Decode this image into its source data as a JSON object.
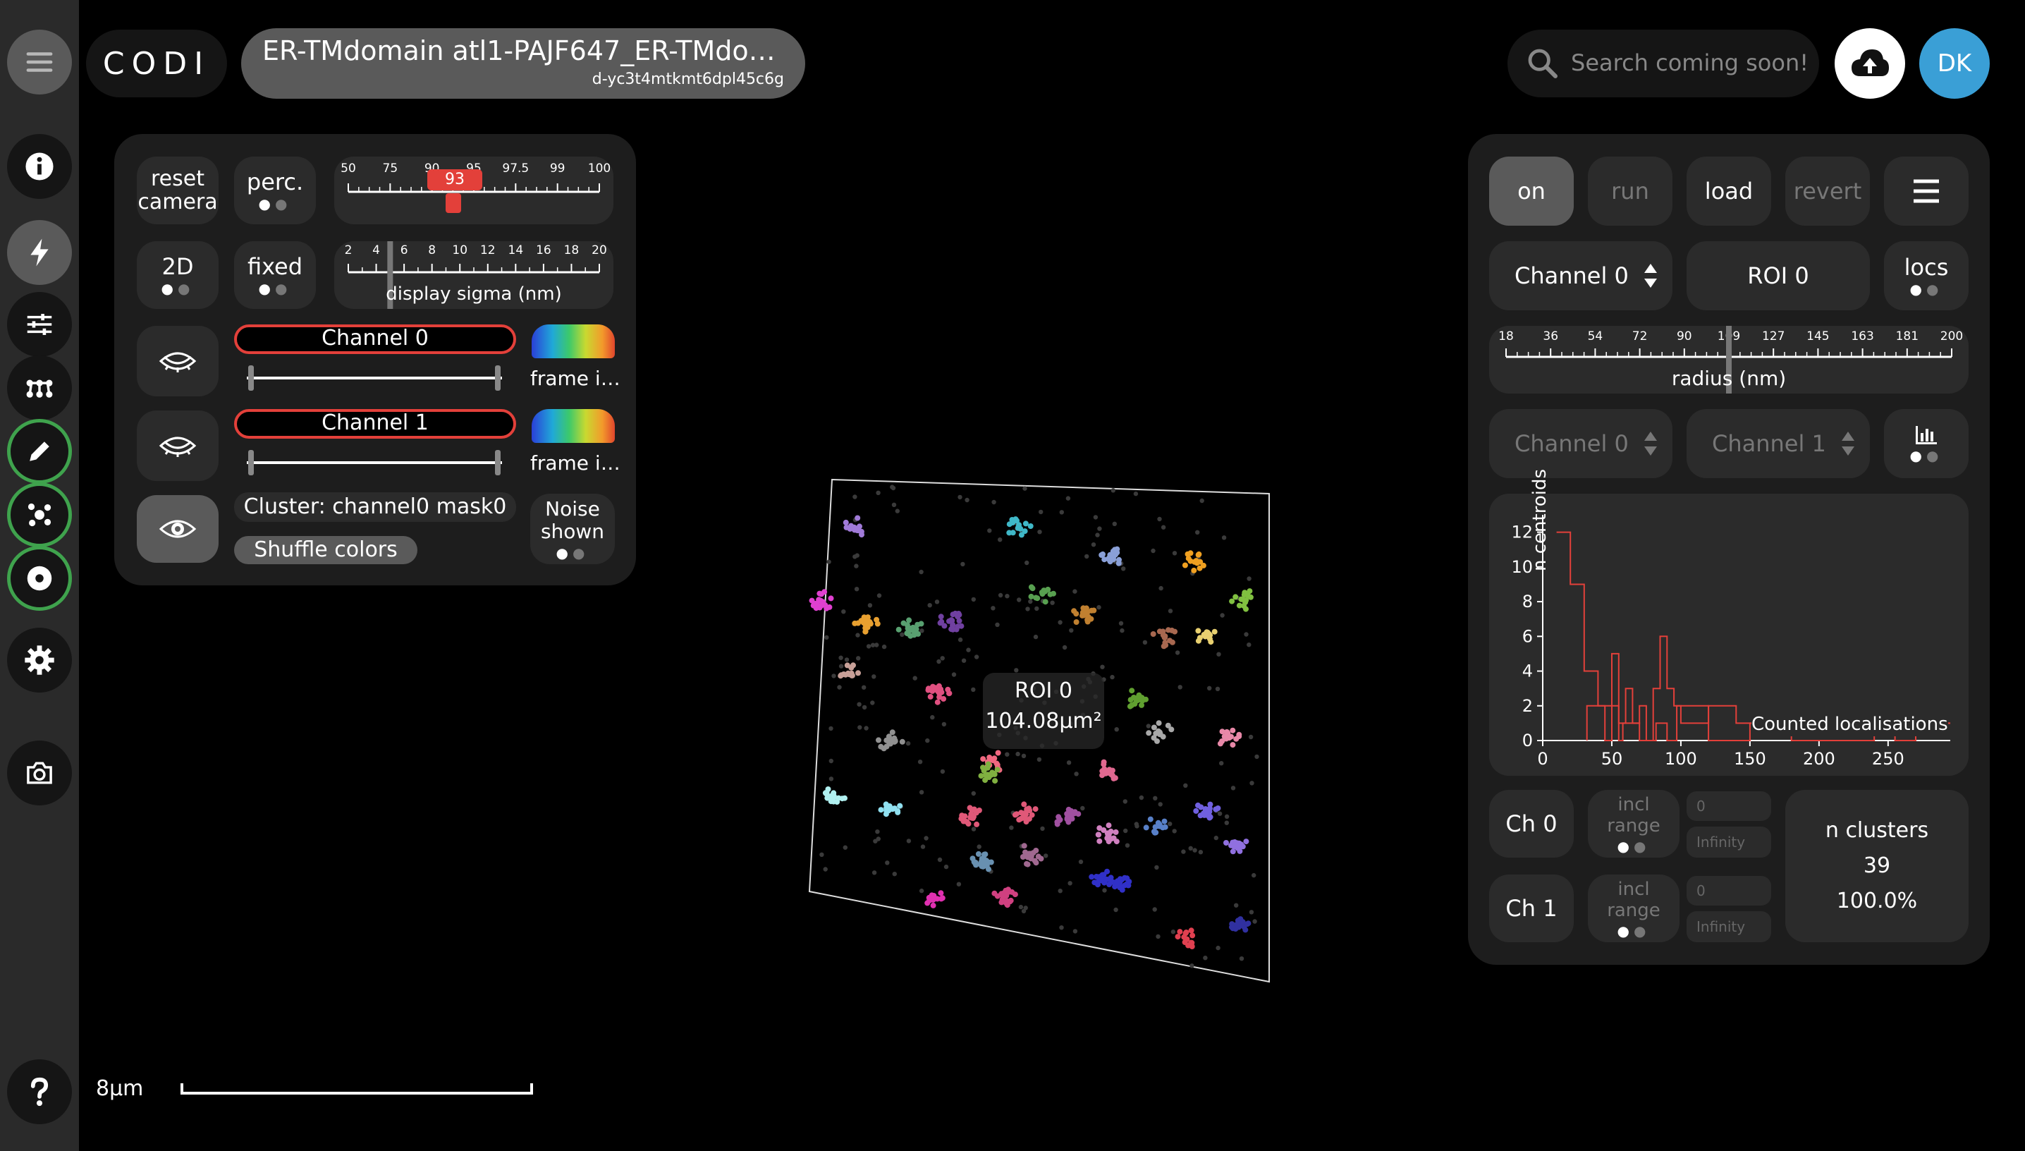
{
  "app": {
    "logo": "CODI",
    "dataset_title": "ER-TMdomain atl1-PAJF647_ER-TMdo…",
    "dataset_id": "d-yc3t4mtkmt6dpl45c6g",
    "search_placeholder": "Search coming soon!",
    "user_initials": "DK",
    "accent_green": "#3fa34d",
    "accent_red": "#e3403a",
    "avatar_color": "#3a9fd6"
  },
  "sidebar": {
    "items": [
      {
        "icon": "hamburger-menu-icon"
      },
      {
        "icon": "info-icon"
      },
      {
        "icon": "lightning-icon"
      },
      {
        "icon": "sliders-icon"
      },
      {
        "icon": "network-icon"
      },
      {
        "icon": "pencil-icon"
      },
      {
        "icon": "cluster-icon"
      },
      {
        "icon": "target-icon"
      },
      {
        "icon": "gear-icon"
      },
      {
        "icon": "camera-icon"
      },
      {
        "icon": "help-icon"
      }
    ]
  },
  "left_panel": {
    "reset_camera": "reset\ncamera",
    "percentile": "perc.",
    "percentile_value": "93",
    "percentile_level": 93,
    "percentile_ticks": [
      "50",
      "75",
      "90",
      "95",
      "97.5",
      "99",
      "100"
    ],
    "mode_2d": "2D",
    "fixed": "fixed",
    "sigma_ticks": [
      "2",
      "4",
      "6",
      "8",
      "10",
      "12",
      "14",
      "16",
      "18",
      "20"
    ],
    "sigma_label": "display sigma (nm)",
    "sigma_value": 5,
    "channels": [
      {
        "name": "Channel 0",
        "colormap_label": "frame i…"
      },
      {
        "name": "Channel 1",
        "colormap_label": "frame i…"
      }
    ],
    "cluster_label": "Cluster: channel0 mask0",
    "shuffle_colors": "Shuffle colors",
    "noise_shown": "Noise\nshown"
  },
  "viewport": {
    "roi_name": "ROI 0",
    "roi_area": "104.08μm²",
    "scale_label": "8μm"
  },
  "right_panel": {
    "buttons": {
      "on": "on",
      "run": "run",
      "load": "load",
      "revert": "revert"
    },
    "channel_select": "Channel 0",
    "roi_select": "ROI 0",
    "locs": "locs",
    "radius_ticks": [
      "18",
      "36",
      "54",
      "72",
      "90",
      "109",
      "127",
      "145",
      "163",
      "181",
      "200"
    ],
    "radius_label": "radius (nm)",
    "radius_value": 109,
    "channel_a": "Channel 0",
    "channel_b": "Channel 1",
    "ch0": "Ch 0",
    "ch1": "Ch 1",
    "incl_range": "incl\nrange",
    "range_min": "0",
    "range_max": "Infinity",
    "n_clusters_label": "n clusters",
    "n_clusters": "39",
    "n_clusters_pct": "100.0%"
  },
  "chart_data": {
    "type": "line",
    "ylabel": "n centroids",
    "xlabel": "",
    "x_ticks": [
      "0",
      "50",
      "100",
      "150",
      "200",
      "250"
    ],
    "y_ticks": [
      "0",
      "2",
      "4",
      "6",
      "8",
      "10",
      "12"
    ],
    "xlim": [
      0,
      295
    ],
    "ylim": [
      0,
      13
    ],
    "series": [
      {
        "name": "",
        "color": "#e3403a",
        "steps": [
          [
            10,
            12
          ],
          [
            20,
            12
          ],
          [
            20,
            9
          ],
          [
            30,
            9
          ],
          [
            30,
            4
          ],
          [
            40,
            4
          ],
          [
            40,
            2
          ],
          [
            45,
            2
          ],
          [
            45,
            0
          ],
          [
            50,
            0
          ],
          [
            50,
            5
          ],
          [
            55,
            5
          ],
          [
            55,
            1
          ],
          [
            60,
            1
          ],
          [
            60,
            3
          ],
          [
            65,
            3
          ],
          [
            65,
            1
          ],
          [
            70,
            1
          ],
          [
            70,
            2
          ],
          [
            75,
            2
          ],
          [
            75,
            0
          ],
          [
            80,
            0
          ],
          [
            80,
            3
          ],
          [
            85,
            3
          ],
          [
            85,
            6
          ],
          [
            90,
            6
          ],
          [
            90,
            3
          ],
          [
            95,
            3
          ],
          [
            95,
            2
          ],
          [
            100,
            2
          ],
          [
            100,
            1
          ],
          [
            120,
            1
          ],
          [
            120,
            2
          ],
          [
            140,
            2
          ],
          [
            140,
            1
          ],
          [
            180,
            1
          ],
          [
            180,
            0
          ],
          [
            240,
            0
          ],
          [
            240,
            1
          ],
          [
            295,
            1
          ]
        ]
      },
      {
        "name": "Counted localisations",
        "color": "#e3403a",
        "steps": [
          [
            32,
            0
          ],
          [
            32,
            2
          ],
          [
            55,
            2
          ],
          [
            55,
            0
          ],
          [
            58,
            0
          ],
          [
            58,
            1
          ],
          [
            70,
            1
          ],
          [
            70,
            0
          ],
          [
            82,
            0
          ],
          [
            82,
            1
          ],
          [
            90,
            1
          ],
          [
            90,
            0
          ],
          [
            97,
            0
          ],
          [
            97,
            2
          ],
          [
            120,
            2
          ],
          [
            120,
            0
          ],
          [
            150,
            0
          ],
          [
            150,
            1
          ],
          [
            255,
            1
          ],
          [
            255,
            0
          ],
          [
            270,
            0
          ],
          [
            270,
            1
          ],
          [
            295,
            1
          ]
        ]
      }
    ]
  }
}
